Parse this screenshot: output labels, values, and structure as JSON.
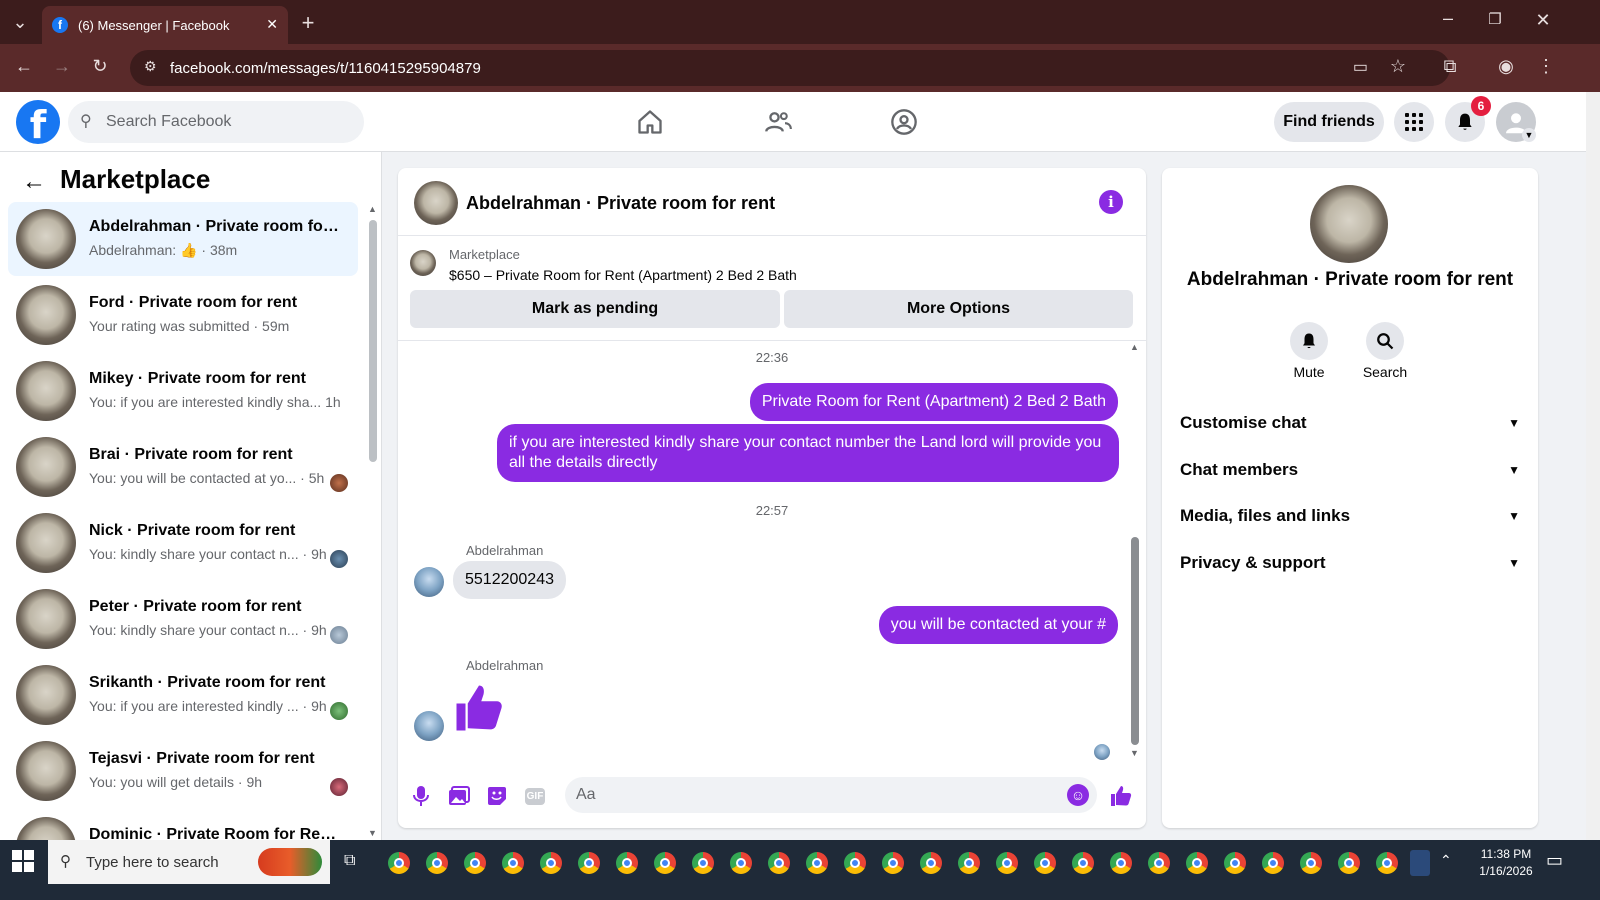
{
  "browser": {
    "tab_title": "(6) Messenger | Facebook",
    "url": "facebook.com/messages/t/1160415295904879"
  },
  "header": {
    "search_placeholder": "Search Facebook",
    "find_friends": "Find friends",
    "notification_count": "6"
  },
  "sidebar": {
    "title": "Marketplace",
    "conversations": [
      {
        "name": "Abdelrahman · Private room for ...",
        "preview": "Abdelrahman:",
        "time": "38m",
        "active": true
      },
      {
        "name": "Ford · Private room for rent",
        "preview": "Your rating was submitted",
        "time": "59m"
      },
      {
        "name": "Mikey · Private room for rent",
        "preview": "You: if you are interested kindly sha...",
        "time": "1h"
      },
      {
        "name": "Brai · Private room for rent",
        "preview": "You: you will be contacted at yo...",
        "time": "5h"
      },
      {
        "name": "Nick · Private room for rent",
        "preview": "You: kindly share your contact n...",
        "time": "9h"
      },
      {
        "name": "Peter · Private room for rent",
        "preview": "You: kindly share your contact n...",
        "time": "9h"
      },
      {
        "name": "Srikanth · Private room for rent",
        "preview": "You: if you are interested kindly ...",
        "time": "9h"
      },
      {
        "name": "Tejasvi · Private room for rent",
        "preview": "You: you will get details",
        "time": "9h"
      },
      {
        "name": "Dominic · Private Room for Rent...",
        "preview": "",
        "time": ""
      }
    ]
  },
  "chat": {
    "title": "Abdelrahman · Private room for rent",
    "marketplace_label": "Marketplace",
    "listing": "$650 – Private Room for Rent (Apartment) 2 Bed 2 Bath",
    "mark_pending": "Mark as pending",
    "more_options": "More Options",
    "ts1": "22:36",
    "msg_out_1": "Private Room for Rent (Apartment) 2 Bed 2 Bath",
    "msg_out_2": "if you are interested kindly share your contact number the Land lord will provide you all the details directly",
    "ts2": "22:57",
    "sender_1": "Abdelrahman",
    "msg_in_1": "5512200243",
    "msg_out_3": "you will be contacted at your #",
    "sender_2": "Abdelrahman",
    "composer_placeholder": "Aa",
    "gif_label": "GIF"
  },
  "details": {
    "name": "Abdelrahman · Private room for rent",
    "mute": "Mute",
    "search": "Search",
    "sections": [
      "Customise chat",
      "Chat members",
      "Media, files and links",
      "Privacy & support"
    ]
  },
  "taskbar": {
    "search_placeholder": "Type here to search",
    "time": "11:38 PM",
    "date": "1/16/2026"
  },
  "colors": {
    "brand": "#1877f2",
    "accent": "#8a2be2"
  }
}
